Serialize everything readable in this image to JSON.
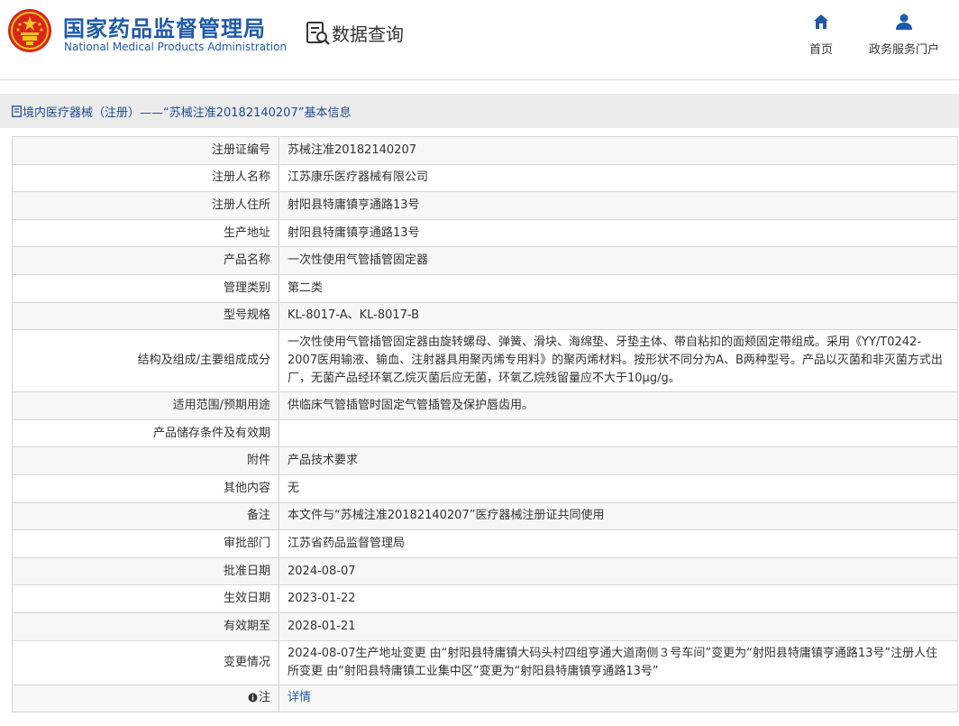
{
  "header": {
    "title_cn": "国家药品监督管理局",
    "title_en": "National Medical Products Administration",
    "query_label": "数据查询",
    "nav": [
      {
        "label": "首页",
        "icon": "home-icon"
      },
      {
        "label": "政务服务门户",
        "icon": "user-icon"
      }
    ]
  },
  "breadcrumb": {
    "text": "境内医疗器械（注册）——“苏械注准20182140207”基本信息"
  },
  "details": [
    {
      "label": "注册证编号",
      "value": "苏械注准20182140207"
    },
    {
      "label": "注册人名称",
      "value": "江苏康乐医疗器械有限公司"
    },
    {
      "label": "注册人住所",
      "value": "射阳县特庸镇亨通路13号"
    },
    {
      "label": "生产地址",
      "value": "射阳县特庸镇亨通路13号"
    },
    {
      "label": "产品名称",
      "value": "一次性使用气管插管固定器"
    },
    {
      "label": "管理类别",
      "value": "第二类"
    },
    {
      "label": "型号规格",
      "value": "KL-8017-A、KL-8017-B"
    },
    {
      "label": "结构及组成/主要组成成分",
      "value": "一次性使用气管插管固定器由旋转螺母、弹簧、滑块、海绵垫、牙垫主体、带自粘扣的面颊固定带组成。采用《YY/T0242-2007医用输液、输血、注射器具用聚丙烯专用料》的聚丙烯材料。按形状不同分为A、B两种型号。产品以灭菌和非灭菌方式出厂，无菌产品经环氧乙烷灭菌后应无菌，环氧乙烷残留量应不大于10μg/g。"
    },
    {
      "label": "适用范围/预期用途",
      "value": "供临床气管插管时固定气管插管及保护唇齿用。"
    },
    {
      "label": "产品储存条件及有效期",
      "value": ""
    },
    {
      "label": "附件",
      "value": "产品技术要求"
    },
    {
      "label": "其他内容",
      "value": "无"
    },
    {
      "label": "备注",
      "value": "本文件与“苏械注准20182140207”医疗器械注册证共同使用"
    },
    {
      "label": "审批部门",
      "value": "江苏省药品监督管理局"
    },
    {
      "label": "批准日期",
      "value": "2024-08-07"
    },
    {
      "label": "生效日期",
      "value": "2023-01-22"
    },
    {
      "label": "有效期至",
      "value": "2028-01-21"
    },
    {
      "label": "变更情况",
      "value": "2024-08-07生产地址变更 由“射阳县特庸镇大码头村四组亨通大道南侧３号车间”变更为“射阳县特庸镇亨通路13号”注册人住所变更 由“射阳县特庸镇工业集中区”变更为“射阳县特庸镇亨通路13号”"
    }
  ],
  "note": {
    "label": "注",
    "link": "详情"
  }
}
